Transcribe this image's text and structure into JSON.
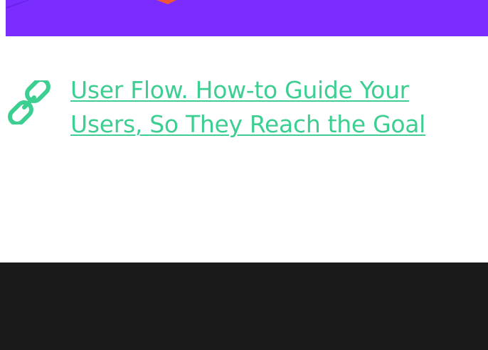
{
  "hero": {
    "background_color": "#7b2cff",
    "accent_color": "#f0553a"
  },
  "related_link": {
    "icon": "link-icon",
    "text": "User Flow. How-to Guide Your Users, So They Reach the Goal",
    "color": "#3ccf91"
  },
  "footer": {
    "background_color": "#1a1a1a"
  }
}
